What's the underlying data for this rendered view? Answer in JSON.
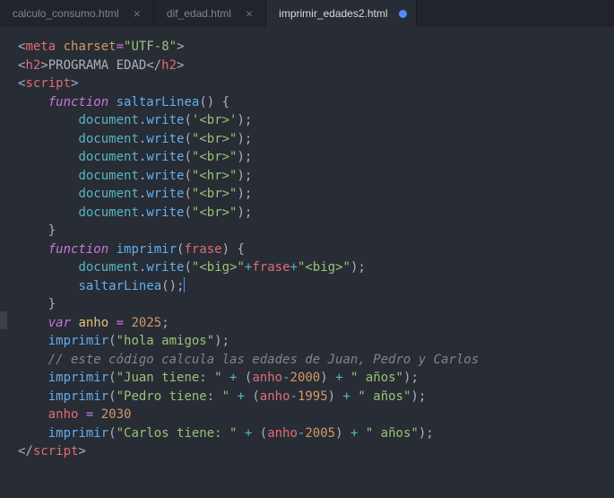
{
  "tabs": [
    {
      "label": "calculo_consumo.html",
      "active": false,
      "dirty": false
    },
    {
      "label": "dif_edad.html",
      "active": false,
      "dirty": false
    },
    {
      "label": "imprimir_edades2.html",
      "active": true,
      "dirty": true
    }
  ],
  "code": {
    "l1": {
      "lt": "<",
      "tag": "meta",
      "sp": " ",
      "attr": "charset",
      "eq": "=",
      "val": "\"UTF-8\"",
      "gt": ">"
    },
    "l2": {
      "lt1": "<",
      "tag1": "h2",
      "gt1": ">",
      "text": "PROGRAMA EDAD",
      "lt2": "</",
      "tag2": "h2",
      "gt2": ">"
    },
    "l3": {
      "lt": "<",
      "tag": "script",
      "gt": ">"
    },
    "l4": {
      "ind": "    ",
      "kw": "function",
      "sp": " ",
      "fn": "saltarLinea",
      "par": "()",
      "sp2": " ",
      "br": "{"
    },
    "l5": {
      "ind": "        ",
      "obj": "document",
      "dot": ".",
      "fn": "write",
      "op": "(",
      "str": "'<br>'",
      "cp": ")",
      "sc": ";"
    },
    "l6": {
      "ind": "        ",
      "obj": "document",
      "dot": ".",
      "fn": "write",
      "op": "(",
      "str": "\"<br>\"",
      "cp": ")",
      "sc": ";"
    },
    "l7": {
      "ind": "        ",
      "obj": "document",
      "dot": ".",
      "fn": "write",
      "op": "(",
      "str": "\"<br>\"",
      "cp": ")",
      "sc": ";"
    },
    "l8": {
      "ind": "        ",
      "obj": "document",
      "dot": ".",
      "fn": "write",
      "op": "(",
      "str": "\"<hr>\"",
      "cp": ")",
      "sc": ";"
    },
    "l9": {
      "ind": "        ",
      "obj": "document",
      "dot": ".",
      "fn": "write",
      "op": "(",
      "str": "\"<br>\"",
      "cp": ")",
      "sc": ";"
    },
    "l10": {
      "ind": "        ",
      "obj": "document",
      "dot": ".",
      "fn": "write",
      "op": "(",
      "str": "\"<br>\"",
      "cp": ")",
      "sc": ";"
    },
    "l11": {
      "ind": "    ",
      "br": "}"
    },
    "l12": {
      "ind": "    ",
      "kw": "function",
      "sp": " ",
      "fn": "imprimir",
      "op": "(",
      "arg": "frase",
      "cp": ")",
      "sp2": " ",
      "br": "{"
    },
    "l13": {
      "ind": "        ",
      "obj": "document",
      "dot": ".",
      "fn": "write",
      "op": "(",
      "s1": "\"<big>\"",
      "plus1": "+",
      "var": "frase",
      "plus2": "+",
      "s2": "\"<big>\"",
      "cp": ")",
      "sc": ";"
    },
    "l14": {
      "ind": "        ",
      "fn": "saltarLinea",
      "par": "()",
      "sc": ";"
    },
    "l15": {
      "ind": "    ",
      "br": "}"
    },
    "l16": {
      "ind": "    ",
      "kw": "var",
      "sp": " ",
      "name": "anho",
      "sp2": " ",
      "eq": "=",
      "sp3": " ",
      "num": "2025",
      "sc": ";"
    },
    "l17": {
      "ind": "    ",
      "fn": "imprimir",
      "op": "(",
      "str": "\"hola amigos\"",
      "cp": ")",
      "sc": ";"
    },
    "l18": {
      "ind": "    ",
      "text": "// este código calcula las edades de Juan, Pedro y Carlos"
    },
    "l19": {
      "ind": "    ",
      "fn": "imprimir",
      "op": "(",
      "s1": "\"Juan tiene: \"",
      "sp1": " ",
      "plus1": "+",
      "sp2": " ",
      "op2": "(",
      "var": "anho",
      "minus": "-",
      "num": "2000",
      "cp2": ")",
      "sp3": " ",
      "plus2": "+",
      "sp4": " ",
      "s2": "\" años\"",
      "cp": ")",
      "sc": ";"
    },
    "l20": {
      "ind": "    ",
      "fn": "imprimir",
      "op": "(",
      "s1": "\"Pedro tiene: \"",
      "sp1": " ",
      "plus1": "+",
      "sp2": " ",
      "op2": "(",
      "var": "anho",
      "minus": "-",
      "num": "1995",
      "cp2": ")",
      "sp3": " ",
      "plus2": "+",
      "sp4": " ",
      "s2": "\" años\"",
      "cp": ")",
      "sc": ";"
    },
    "l21": {
      "ind": "    ",
      "name": "anho",
      "sp": " ",
      "eq": "=",
      "sp2": " ",
      "num": "2030"
    },
    "l22": {
      "ind": "    ",
      "fn": "imprimir",
      "op": "(",
      "s1": "\"Carlos tiene: \"",
      "sp1": " ",
      "plus1": "+",
      "sp2": " ",
      "op2": "(",
      "var": "anho",
      "minus": "-",
      "num": "2005",
      "cp2": ")",
      "sp3": " ",
      "plus2": "+",
      "sp4": " ",
      "s2": "\" años\"",
      "cp": ")",
      "sc": ";"
    },
    "l23": {
      "lt": "</",
      "tag": "script",
      "gt": ">"
    }
  }
}
